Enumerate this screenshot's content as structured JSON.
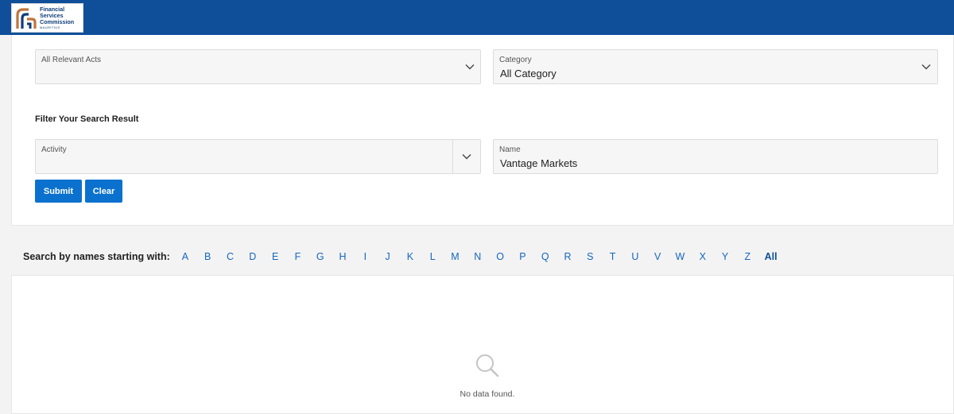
{
  "header": {
    "logo_lines": [
      "Financial",
      "Services",
      "Commission"
    ],
    "logo_subtext": "MAURITIUS",
    "bar_color": "#0f4f9a"
  },
  "filters": {
    "relevant_acts": {
      "placeholder": "All Relevant Acts"
    },
    "category": {
      "label": "Category",
      "value": "All Category"
    },
    "section_title": "Filter Your Search Result",
    "activity": {
      "label": "Activity"
    },
    "name": {
      "label": "Name",
      "value": "Vantage Markets"
    },
    "submit_label": "Submit",
    "clear_label": "Clear",
    "button_color": "#0b71cf"
  },
  "alphabet": {
    "label": "Search by names starting with:",
    "letters": [
      "A",
      "B",
      "C",
      "D",
      "E",
      "F",
      "G",
      "H",
      "I",
      "J",
      "K",
      "L",
      "M",
      "N",
      "O",
      "P",
      "Q",
      "R",
      "S",
      "T",
      "U",
      "V",
      "W",
      "X",
      "Y",
      "Z"
    ],
    "all_label": "All",
    "link_color": "#1565c0"
  },
  "results": {
    "empty_icon": "search-icon",
    "empty_text": "No data found."
  }
}
